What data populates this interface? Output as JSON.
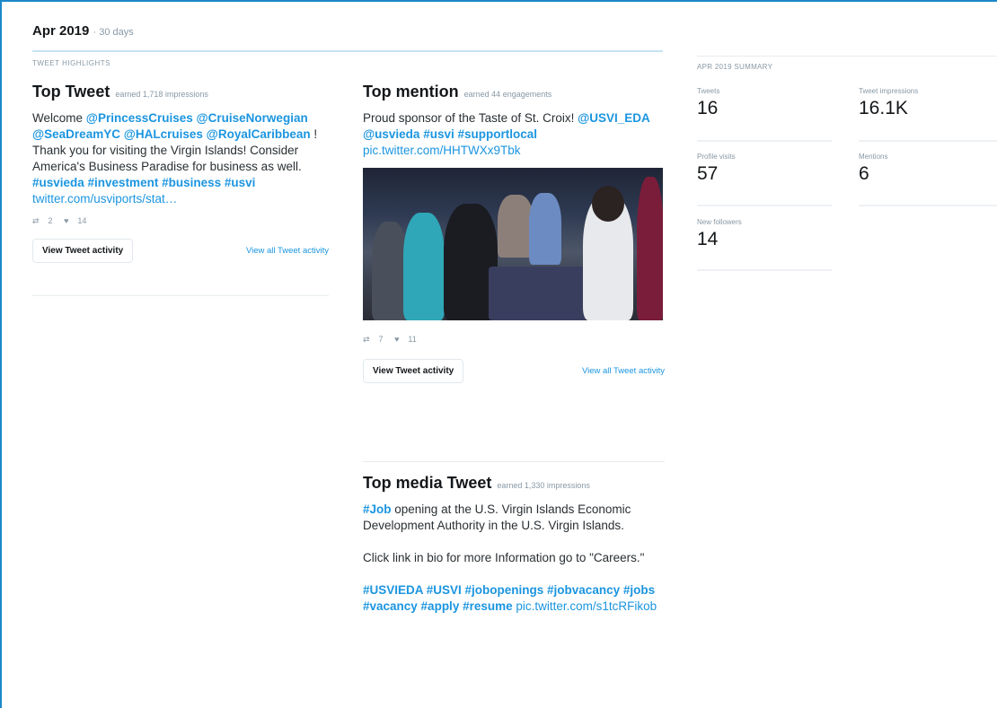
{
  "period": {
    "title": "Apr 2019",
    "days": "· 30 days"
  },
  "highlights_label": "TWEET HIGHLIGHTS",
  "top_tweet": {
    "title": "Top Tweet",
    "earned": "earned 1,718 impressions",
    "segments": [
      {
        "t": "Welcome ",
        "k": "text"
      },
      {
        "t": "@PrincessCruises @CruiseNorwegian @SeaDreamYC @HALcruises @RoyalCaribbean",
        "k": "link"
      },
      {
        "t": " ! Thank you for visiting the Virgin Islands! Consider America's Business Paradise for business as well. ",
        "k": "text"
      },
      {
        "t": "#usvieda #investment #business #usvi",
        "k": "link"
      },
      {
        "t": " twitter.com/usviports/stat…",
        "k": "url"
      }
    ],
    "retweets": "2",
    "likes": "14",
    "button": "View Tweet activity",
    "view_all": "View all Tweet activity"
  },
  "top_mention": {
    "title": "Top mention",
    "earned": "earned 44 engagements",
    "segments": [
      {
        "t": "Proud sponsor of the Taste of St. Croix! ",
        "k": "text"
      },
      {
        "t": "@USVI_EDA @usvieda #usvi #supportlocal",
        "k": "link"
      },
      {
        "t": " pic.twitter.com/HHTWXx9Tbk",
        "k": "url"
      }
    ],
    "retweets": "7",
    "likes": "11",
    "button": "View Tweet activity",
    "view_all": "View all Tweet activity"
  },
  "top_media": {
    "title": "Top media Tweet",
    "earned": "earned 1,330 impressions",
    "p1": [
      {
        "t": "#Job",
        "k": "link"
      },
      {
        "t": " opening at the U.S. Virgin Islands Economic Development Authority in the U.S. Virgin Islands.",
        "k": "text"
      }
    ],
    "p2": [
      {
        "t": "Click link in bio for more Information go to \"Careers.\"",
        "k": "text"
      }
    ],
    "p3": [
      {
        "t": "#USVIEDA #USVI #jobopenings #jobvacancy #jobs #vacancy #apply #resume",
        "k": "link"
      },
      {
        "t": " pic.twitter.com/s1tcRFikob",
        "k": "url"
      }
    ]
  },
  "summary": {
    "label": "APR 2019 SUMMARY",
    "stats": [
      {
        "label": "Tweets",
        "value": "16"
      },
      {
        "label": "Tweet impressions",
        "value": "16.1K"
      },
      {
        "label": "Profile visits",
        "value": "57"
      },
      {
        "label": "Mentions",
        "value": "6"
      },
      {
        "label": "New followers",
        "value": "14"
      }
    ]
  },
  "icons": {
    "retweet": "retweet-icon",
    "like": "heart-icon"
  },
  "colors": {
    "accent": "#1b95e0",
    "frame": "#1c88c9"
  }
}
